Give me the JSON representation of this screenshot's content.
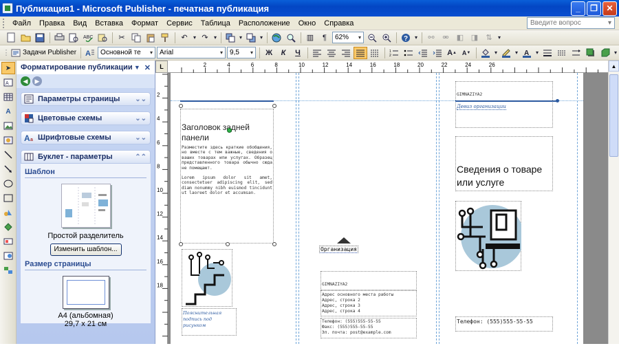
{
  "window": {
    "title": "Публикация1 - Microsoft Publisher - печатная публикация",
    "minimize": "_",
    "restore": "❐",
    "close": "✕"
  },
  "menu": {
    "items": [
      "Файл",
      "Правка",
      "Вид",
      "Вставка",
      "Формат",
      "Сервис",
      "Таблица",
      "Расположение",
      "Окно",
      "Справка"
    ],
    "help_placeholder": "Введите вопрос"
  },
  "toolbar1": {
    "zoom": "62%"
  },
  "toolbar2": {
    "tasks_label": "Задачи Publisher",
    "style_value": "Основной те",
    "font_value": "Arial",
    "size_value": "9,5",
    "bold": "Ж",
    "italic": "К",
    "underline": "Ч"
  },
  "taskpane": {
    "title": "Форматирование публикации",
    "sections": [
      {
        "label": "Параметры страницы",
        "icon": "page-setup-icon"
      },
      {
        "label": "Цветовые схемы",
        "icon": "color-schemes-icon"
      },
      {
        "label": "Шрифтовые схемы",
        "icon": "font-schemes-icon"
      },
      {
        "label": "Буклет - параметры",
        "icon": "brochure-options-icon"
      }
    ],
    "template_heading": "Шаблон",
    "template_name": "Простой разделитель",
    "change_template_button": "Изменить шаблон...",
    "page_size_heading": "Размер страницы",
    "page_size_name": "A4 (альбомная)",
    "page_size_dims": "29,7 x 21 см"
  },
  "ruler": {
    "h_numbers": [
      "2",
      "4",
      "6",
      "8",
      "10",
      "12",
      "14",
      "16",
      "18",
      "20",
      "22",
      "24",
      "26"
    ],
    "v_numbers": [
      "2",
      "4",
      "6",
      "8",
      "10",
      "12",
      "14",
      "16",
      "18"
    ],
    "corner": "L"
  },
  "document": {
    "back_panel_title": "Заголовок задней панели",
    "back_panel_body": "Разместите здесь краткие обобщения, но вместе с тем важные, сведения о ваших товарах или услугах. Образец представленного товара обычно сюда не помещают.",
    "lorem": "Lorem ipsum dolor sit amet, consectetuer adipiscing elit, sed diam nonummy nibh euismod tincidunt ut laoreet dolor et accumsan.",
    "caption": "Пояснительная подпись под рисунком",
    "org_label": "Организация",
    "org_name": "GIMNAZIYA2",
    "address_lines": [
      "Адрес основного места работы",
      "Адрес, строка 2",
      "Адрес, строка 3",
      "Адрес, строка 4"
    ],
    "phone_block": [
      "Телефон: (555)555-55-55",
      "Факс: (555)555-55-55",
      "Эл. почта: post@example.com"
    ],
    "front_org": "GIMNAZIYA2",
    "front_slogan": "Девиз организации",
    "front_title": "Сведения о товаре или услуге",
    "front_phone": "Телефон: (555)555-55-55"
  },
  "colors": {
    "accent": "#2c5aa0",
    "circle": "#a9c8da",
    "icon_dark": "#111111"
  }
}
